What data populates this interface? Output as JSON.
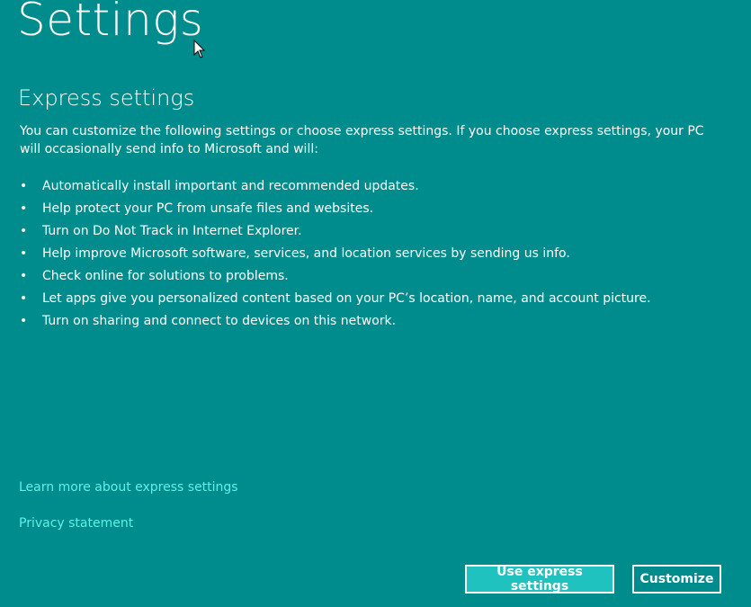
{
  "header": {
    "title": "Settings"
  },
  "main": {
    "heading": "Express settings",
    "intro": "You can customize the following settings or choose express settings. If you choose express settings, your PC will occasionally send info to Microsoft and will:",
    "bullet_glyph": "•",
    "bullets": [
      "Automatically install important and recommended updates.",
      "Help protect your PC from unsafe files and websites.",
      "Turn on Do Not Track in Internet Explorer.",
      "Help improve Microsoft software, services, and location services by sending us info.",
      "Check online for solutions to problems.",
      "Let apps give you personalized content based on your PC’s location, name, and account picture.",
      "Turn on sharing and connect to devices on this network."
    ]
  },
  "links": {
    "learn_more": "Learn more about express settings",
    "privacy": "Privacy statement"
  },
  "buttons": {
    "express": "Use express settings",
    "customize": "Customize"
  },
  "colors": {
    "background": "#008C8C",
    "link": "#5EF2E6",
    "primary_button": "#1FC2BE"
  },
  "icons": {
    "cursor": "mouse-pointer-icon"
  }
}
